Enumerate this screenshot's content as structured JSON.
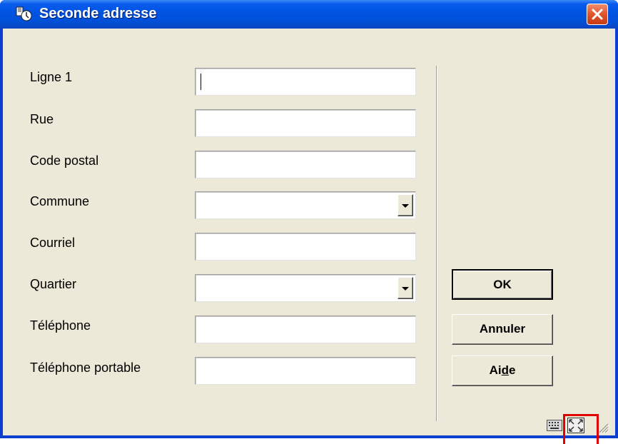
{
  "window": {
    "title": "Seconde adresse",
    "app_icon": "library-app-icon",
    "close_icon": "close-icon"
  },
  "form": {
    "fields": [
      {
        "label": "Ligne 1",
        "value": "",
        "type": "text",
        "focused": true
      },
      {
        "label": "Rue",
        "value": "",
        "type": "text"
      },
      {
        "label": "Code postal",
        "value": "",
        "type": "text"
      },
      {
        "label": "Commune",
        "value": "",
        "type": "dropdown"
      },
      {
        "label": "Courriel",
        "value": "",
        "type": "text"
      },
      {
        "label": "Quartier",
        "value": "",
        "type": "dropdown"
      },
      {
        "label": "Téléphone",
        "value": "",
        "type": "text"
      },
      {
        "label": "Téléphone portable",
        "value": "",
        "type": "text"
      }
    ]
  },
  "buttons": {
    "ok": "OK",
    "cancel": "Annuler",
    "help_prefix": "Ai",
    "help_mnemonic": "d",
    "help_suffix": "e"
  },
  "status_bar": {
    "icons": [
      "keyboard-icon",
      "resize-icon",
      "resize-grip-icon"
    ]
  },
  "colors": {
    "title_bar": "#0054e3",
    "dialog_bg": "#ece9d8",
    "close_button": "#e2582f",
    "highlight_box": "#e00000"
  }
}
